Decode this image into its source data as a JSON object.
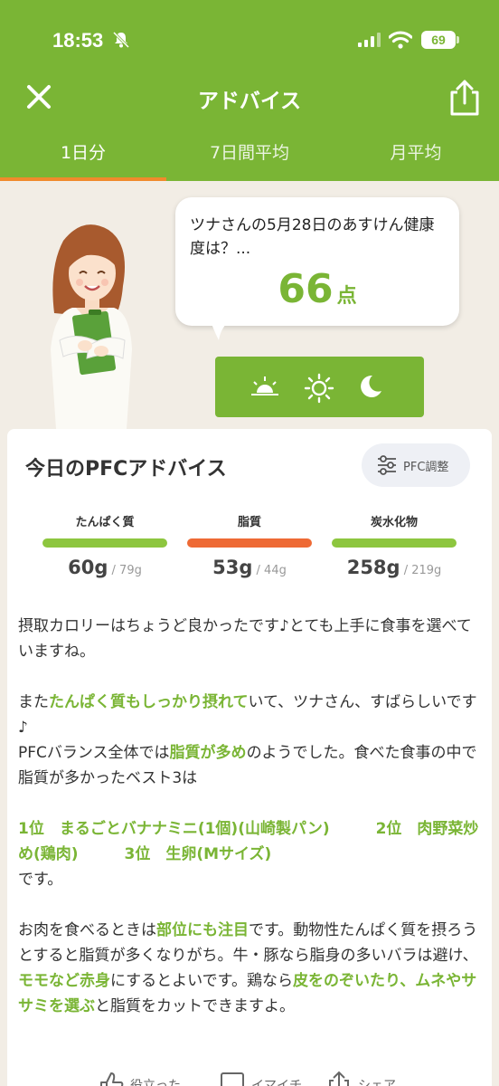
{
  "status": {
    "time": "18:53",
    "battery": "69"
  },
  "header": {
    "title": "アドバイス"
  },
  "tabs": [
    {
      "label": "1日分"
    },
    {
      "label": "7日間平均"
    },
    {
      "label": "月平均"
    }
  ],
  "bubble": {
    "text": "ツナさんの5月28日のあすけん健康度は？...",
    "score": "66",
    "unit": "点"
  },
  "card": {
    "title": "今日のPFCアドバイス",
    "pfc_button": "PFC調整",
    "nutrients": [
      {
        "name": "たんぱく質",
        "value": "60g",
        "target": "/ 79g",
        "color": "#8dc63f"
      },
      {
        "name": "脂質",
        "value": "53g",
        "target": "/ 44g",
        "color": "#ee6a35"
      },
      {
        "name": "炭水化物",
        "value": "258g",
        "target": "/ 219g",
        "color": "#8dc63f"
      }
    ],
    "advice": {
      "p1": "摂取カロリーはちょうど良かったです♪とても上手に食事を選べていますね。",
      "p2a": "また",
      "p2b": "たんぱく質もしっかり摂れて",
      "p2c": "いて、ツナさん、すばらしいです♪",
      "p2d": "PFCバランス全体では",
      "p2e": "脂質が多め",
      "p2f": "のようでした。食べた食事の中で脂質が多かったベスト3は",
      "p3a": "1位　まるごとバナナミニ(1個)(山崎製パン)　　　2位　肉野菜炒め(鶏肉)　　　3位　生卵(Mサイズ)",
      "p3b": "です。",
      "p4a": "お肉を食べるときは",
      "p4b": "部位にも注目",
      "p4c": "です。動物性たんぱく質を摂ろうとすると脂質が多くなりがち。牛・豚なら脂身の多いバラは避け、",
      "p4d": "モモなど赤身",
      "p4e": "にするとよいです。鶏なら",
      "p4f": "皮をのぞいたり、ムネやササミを選ぶ",
      "p4g": "と脂質をカットできますよ。"
    },
    "actions": [
      {
        "label": "役立った"
      },
      {
        "label": "イマイチ"
      },
      {
        "label": "シェア"
      }
    ]
  },
  "colors": {
    "brand": "#7ab535",
    "accent": "#f08a2c",
    "fat": "#ee6a35"
  }
}
